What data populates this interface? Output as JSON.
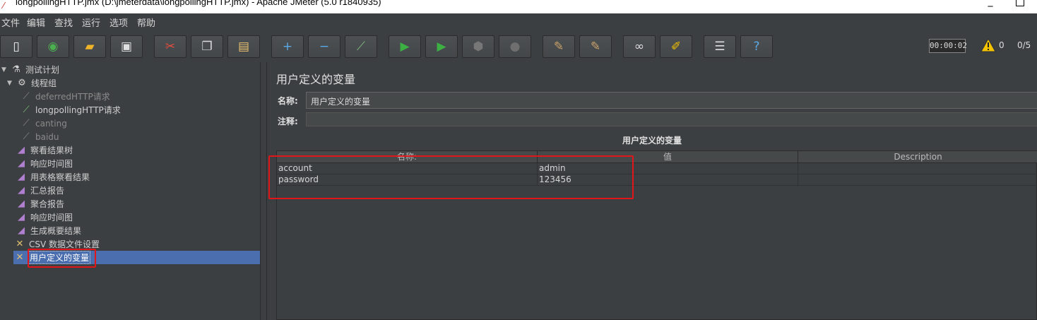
{
  "window": {
    "title": "longpollingHTTP.jmx (D:\\jmeterdata\\longpollingHTTP.jmx) - Apache JMeter (5.0 r1840935)",
    "minimize": "_"
  },
  "menu": [
    "文件",
    "编辑",
    "查找",
    "运行",
    "选项",
    "帮助"
  ],
  "toolbar": {
    "buttons": [
      {
        "name": "new-icon",
        "glyph": "▯",
        "color": "#f0f0f0"
      },
      {
        "name": "templates-icon",
        "glyph": "◉",
        "color": "#4caf50"
      },
      {
        "name": "open-icon",
        "glyph": "▰",
        "color": "#f0b429"
      },
      {
        "name": "save-icon",
        "glyph": "▣",
        "color": "#e0e0e0"
      },
      {
        "name": "cut-icon",
        "glyph": "✂",
        "color": "#e74c3c"
      },
      {
        "name": "copy-icon",
        "glyph": "❐",
        "color": "#dddddd"
      },
      {
        "name": "paste-icon",
        "glyph": "▤",
        "color": "#e8c070"
      },
      {
        "name": "expand-icon",
        "glyph": "+",
        "color": "#5aa9e6"
      },
      {
        "name": "collapse-icon",
        "glyph": "−",
        "color": "#5aa9e6"
      },
      {
        "name": "toggle-icon",
        "glyph": "⟋",
        "color": "#7fbf7f"
      },
      {
        "name": "start-icon",
        "glyph": "▶",
        "color": "#3cb043"
      },
      {
        "name": "start-no-pauses-icon",
        "glyph": "▶",
        "color": "#3cb043"
      },
      {
        "name": "stop-icon",
        "glyph": "⬢",
        "color": "#777777"
      },
      {
        "name": "shutdown-icon",
        "glyph": "●",
        "color": "#6f6f6f"
      },
      {
        "name": "clear-icon",
        "glyph": "✎",
        "color": "#c9a26a"
      },
      {
        "name": "clear-all-icon",
        "glyph": "✎",
        "color": "#c9a26a"
      },
      {
        "name": "search-icon",
        "glyph": "∞",
        "color": "#dddddd"
      },
      {
        "name": "reset-search-icon",
        "glyph": "✐",
        "color": "#f2c200"
      },
      {
        "name": "function-helper-icon",
        "glyph": "☰",
        "color": "#dddddd"
      },
      {
        "name": "help-icon",
        "glyph": "?",
        "color": "#5aa9e6"
      }
    ],
    "elapsed": "00:00:02",
    "warnings": "0",
    "threads": "0/5"
  },
  "tree": [
    {
      "label": "测试计划",
      "icon": "flask-icon",
      "glyph": "⚗",
      "color": "#cfcfcf",
      "level": 0,
      "arrow": "▼",
      "disabled": false,
      "selected": false
    },
    {
      "label": "线程组",
      "icon": "gear-icon",
      "glyph": "⚙",
      "color": "#cfcfcf",
      "level": 1,
      "arrow": "▼",
      "disabled": false,
      "selected": false
    },
    {
      "label": "deferredHTTP请求",
      "icon": "pipette-icon",
      "glyph": "⟋",
      "color": "#888888",
      "level": 2,
      "arrow": "",
      "disabled": true,
      "selected": false
    },
    {
      "label": "longpollingHTTP请求",
      "icon": "pipette-icon",
      "glyph": "⟋",
      "color": "#7fbf7f",
      "level": 2,
      "arrow": "",
      "disabled": false,
      "selected": false
    },
    {
      "label": "canting",
      "icon": "pipette-icon",
      "glyph": "⟋",
      "color": "#888888",
      "level": 2,
      "arrow": "",
      "disabled": true,
      "selected": false
    },
    {
      "label": "baidu",
      "icon": "pipette-icon",
      "glyph": "⟋",
      "color": "#888888",
      "level": 2,
      "arrow": "",
      "disabled": true,
      "selected": false
    },
    {
      "label": "察看结果树",
      "icon": "graph-icon",
      "glyph": "◢",
      "color": "#b07fd0",
      "level": 1,
      "arrow": "",
      "disabled": false,
      "selected": false
    },
    {
      "label": "响应时间图",
      "icon": "graph-icon",
      "glyph": "◢",
      "color": "#b07fd0",
      "level": 1,
      "arrow": "",
      "disabled": false,
      "selected": false
    },
    {
      "label": "用表格察看结果",
      "icon": "graph-icon",
      "glyph": "◢",
      "color": "#b07fd0",
      "level": 1,
      "arrow": "",
      "disabled": false,
      "selected": false
    },
    {
      "label": "汇总报告",
      "icon": "graph-icon",
      "glyph": "◢",
      "color": "#b07fd0",
      "level": 1,
      "arrow": "",
      "disabled": false,
      "selected": false
    },
    {
      "label": "聚合报告",
      "icon": "graph-icon",
      "glyph": "◢",
      "color": "#b07fd0",
      "level": 1,
      "arrow": "",
      "disabled": false,
      "selected": false
    },
    {
      "label": "响应时间图",
      "icon": "graph-icon",
      "glyph": "◢",
      "color": "#b07fd0",
      "level": 1,
      "arrow": "",
      "disabled": false,
      "selected": false
    },
    {
      "label": "生成概要结果",
      "icon": "graph-icon",
      "glyph": "◢",
      "color": "#b07fd0",
      "level": 1,
      "arrow": "",
      "disabled": false,
      "selected": false
    },
    {
      "label": "CSV 数据文件设置",
      "icon": "wrench-icon",
      "glyph": "✕",
      "color": "#e0c070",
      "level": 1,
      "arrow": "",
      "disabled": false,
      "selected": false
    },
    {
      "label": "用户定义的变量",
      "icon": "wrench-icon",
      "glyph": "✕",
      "color": "#e0c070",
      "level": 1,
      "arrow": "",
      "disabled": false,
      "selected": true
    }
  ],
  "panel": {
    "title": "用户定义的变量",
    "name_label": "名称:",
    "name_value": "用户定义的变量",
    "comment_label": "注释:",
    "comment_value": "",
    "table_caption": "用户定义的变量",
    "columns": [
      "名称:",
      "值",
      "Description"
    ],
    "rows": [
      [
        "account",
        "admin",
        ""
      ],
      [
        "password",
        "123456",
        ""
      ]
    ]
  }
}
